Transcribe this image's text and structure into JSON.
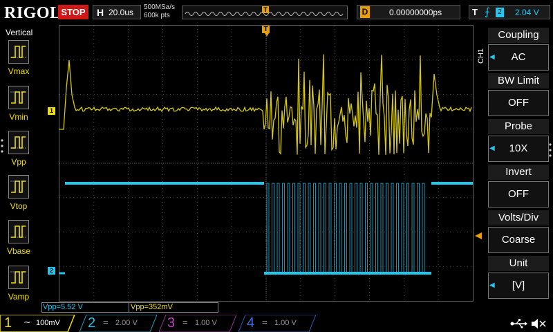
{
  "topbar": {
    "logo": "RIGOL",
    "run_state": "STOP",
    "timebase_label": "H",
    "timebase_value": "20.0us",
    "sample_rate": "500MSa/s",
    "memory_depth": "600k pts",
    "trigger_marker": "T",
    "delay_label": "D",
    "delay_value": "0.00000000ps",
    "trigger_label": "T",
    "trigger_edge_icon": "rising-edge-icon",
    "trigger_source": "2",
    "trigger_level": "2.04 V"
  },
  "left_menu": {
    "title": "Vertical",
    "items": [
      {
        "label": "Vmax"
      },
      {
        "label": "Vmin"
      },
      {
        "label": "Vpp"
      },
      {
        "label": "Vtop"
      },
      {
        "label": "Vbase"
      },
      {
        "label": "Vamp"
      }
    ]
  },
  "right_menu": {
    "channel": "CH1",
    "items": [
      {
        "title": "Coupling",
        "value": "AC",
        "has_arrow": true
      },
      {
        "title": "BW Limit",
        "value": "OFF",
        "has_arrow": false
      },
      {
        "title": "Probe",
        "value": "10X",
        "has_arrow": true
      },
      {
        "title": "Invert",
        "value": "OFF",
        "has_arrow": false
      },
      {
        "title": "Volts/Div",
        "value": "Coarse",
        "has_arrow": false
      },
      {
        "title": "Unit",
        "value": "[V]",
        "has_arrow": true
      }
    ]
  },
  "markers": {
    "ch1": "1",
    "ch2": "2",
    "trigger_top": "T"
  },
  "measurements": {
    "m1": "Vpp=5.52 V",
    "m2": "Vpp=352mV"
  },
  "channels": [
    {
      "num": "1",
      "coupling_icon": "ac-coupling-icon",
      "scale": "100mV",
      "color": "#f0e000",
      "active": true
    },
    {
      "num": "2",
      "coupling_icon": "dc-coupling-icon",
      "scale": "2.00 V",
      "color": "#22c7ee",
      "active": false
    },
    {
      "num": "3",
      "coupling_icon": "dc-coupling-icon",
      "scale": "1.00 V",
      "color": "#c040c0",
      "active": false
    },
    {
      "num": "4",
      "coupling_icon": "dc-coupling-icon",
      "scale": "1.00 V",
      "color": "#4070e0",
      "active": false
    }
  ],
  "status_icons": [
    "usb-icon",
    "speaker-mute-icon"
  ],
  "colors": {
    "ch1": "#f0e000",
    "ch2": "#22c7ee",
    "ch3": "#c040c0",
    "ch4": "#4070e0",
    "stop": "#d01818",
    "trigger": "#e8a000"
  }
}
